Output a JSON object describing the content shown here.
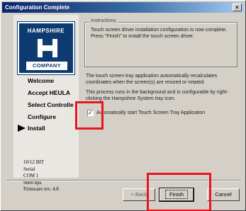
{
  "window": {
    "title": "Configuration Complete",
    "close_glyph": "×"
  },
  "sidebar": {
    "logo": {
      "top_text": "HAMPSHIRE",
      "bottom_text": "COMPANY"
    },
    "steps": [
      {
        "label": "Welcome",
        "current": false
      },
      {
        "label": "Accept HEULA",
        "current": false
      },
      {
        "label": "Select Controlle",
        "current": false
      },
      {
        "label": "Configure",
        "current": false
      },
      {
        "label": "Install",
        "current": true
      }
    ],
    "specs": [
      "10/12 BIT",
      "Serial",
      "COM 1",
      "9600 bps",
      "Firmware rev. 4.8"
    ]
  },
  "instructions": {
    "legend": "Instructions",
    "text": "Touch screen driver installation configuration is now complete.  Press \"Finish\" to install the touch screen driver."
  },
  "body": {
    "para1": "The touch screen tray application automatically recalculates coordinates when the screen(s) are resized or rotated.",
    "para2": "This process runs in the background and is configurable by right-clicking the Hampshire System tray icon."
  },
  "checkbox": {
    "label": "Automatically start Touch Screen Tray Application",
    "checked_glyph": "✓"
  },
  "buttons": {
    "back": "< Back",
    "finish": "Finish",
    "cancel": "Cancel"
  },
  "colors": {
    "title_start": "#0a246a",
    "title_end": "#a6caf0",
    "logo_blue": "#0d3a70",
    "highlight_red": "#e8141e"
  }
}
